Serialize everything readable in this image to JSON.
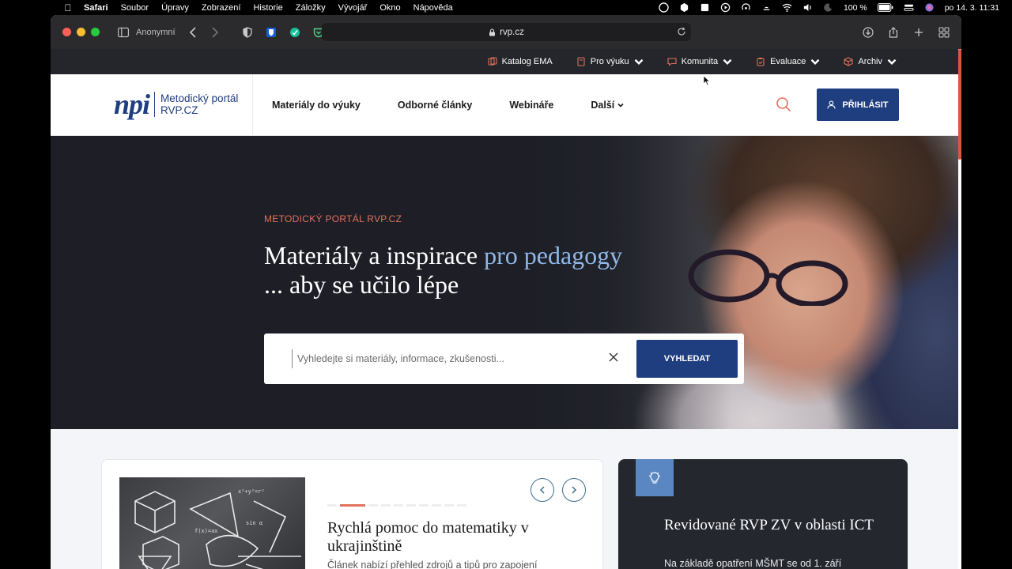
{
  "menubar": {
    "app": "Safari",
    "items": [
      "Soubor",
      "Úpravy",
      "Zobrazení",
      "Historie",
      "Záložky",
      "Vývojář",
      "Okno",
      "Nápověda"
    ],
    "battery": "100 %",
    "datetime": "po 14. 3.  11:31"
  },
  "browser": {
    "profile": "Anonymní",
    "url": "rvp.cz"
  },
  "topstrip": {
    "items": [
      {
        "label": "Katalog EMA",
        "icon": "catalog-icon"
      },
      {
        "label": "Pro výuku",
        "icon": "book-icon"
      },
      {
        "label": "Komunita",
        "icon": "chat-icon"
      },
      {
        "label": "Evaluace",
        "icon": "clipboard-icon"
      },
      {
        "label": "Archiv",
        "icon": "box-icon"
      }
    ]
  },
  "logo": {
    "mark": "npi",
    "line1": "Metodický portál",
    "line2": "RVP.CZ"
  },
  "nav": {
    "items": [
      "Materiály do výuky",
      "Odborné články",
      "Webináře",
      "Další"
    ],
    "login": "PŘIHLÁSIT"
  },
  "hero": {
    "kicker": "METODICKÝ PORTÁL RVP.CZ",
    "title_main": "Materiály a inspirace ",
    "title_accent": "pro pedagogy",
    "title_line2": "... aby se učilo lépe",
    "search_placeholder": "Vyhledejte si materiály, informace, zkušenosti...",
    "search_button": "VYHLEDAT"
  },
  "featured": {
    "title": "Rychlá pomoc do matematiky v ukrajinštině",
    "text": "Článek nabízí přehled zdrojů a tipů pro zapojení"
  },
  "news": {
    "title": "Revidované RVP ZV v oblasti ICT",
    "text": "Na základě opatření MŠMT se od 1. září"
  },
  "colors": {
    "brand": "#1f3e80",
    "accent": "#e0715c",
    "hero_accent": "#8fb8e8",
    "dark": "#24262b"
  }
}
